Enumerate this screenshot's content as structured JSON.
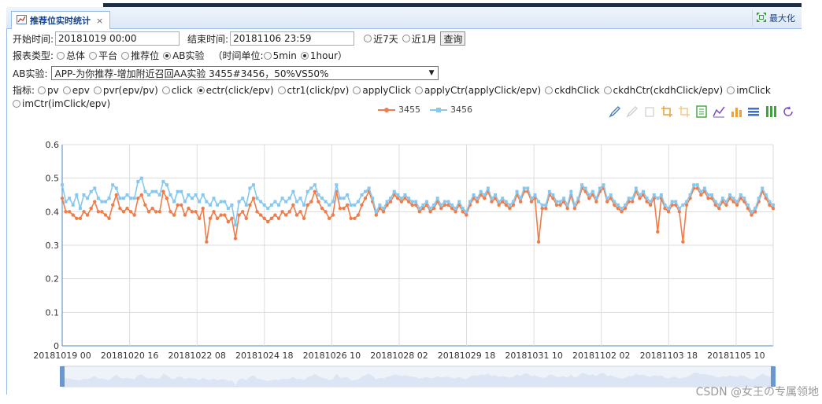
{
  "tab": {
    "title": "推荐位实时统计",
    "close": "×",
    "maximize": "最大化"
  },
  "filters": {
    "start_label": "开始时间:",
    "start_value": "20181019 00:00",
    "end_label": "结束时间:",
    "end_value": "20181106 23:59",
    "range_options": [
      {
        "label": "近7天",
        "checked": false
      },
      {
        "label": "近1月",
        "checked": false
      }
    ],
    "query_button": "查询"
  },
  "report": {
    "label": "报表类型:",
    "types": [
      {
        "label": "总体",
        "checked": false
      },
      {
        "label": "平台",
        "checked": false
      },
      {
        "label": "推荐位",
        "checked": false
      },
      {
        "label": "AB实验",
        "checked": true
      }
    ],
    "unit_label": "（时间单位:",
    "units": [
      {
        "label": "5min",
        "checked": false
      },
      {
        "label": "1hour",
        "checked": true
      }
    ],
    "unit_close": "）"
  },
  "ab": {
    "label": "AB实验:",
    "selected": "APP-为你推荐-增加附近召回AA实验 3455#3456，50%VS50%"
  },
  "metrics": {
    "label": "指标:",
    "options": [
      {
        "label": "pv",
        "checked": false
      },
      {
        "label": "epv",
        "checked": false
      },
      {
        "label": "pvr(epv/pv)",
        "checked": false
      },
      {
        "label": "click",
        "checked": false
      },
      {
        "label": "ectr(click/epv)",
        "checked": true
      },
      {
        "label": "ctr1(click/pv)",
        "checked": false
      },
      {
        "label": "applyClick",
        "checked": false
      },
      {
        "label": "applyCtr(applyClick/epv)",
        "checked": false
      },
      {
        "label": "ckdhClick",
        "checked": false
      },
      {
        "label": "ckdhCtr(ckdhClick/epv)",
        "checked": false
      },
      {
        "label": "imClick",
        "checked": false
      },
      {
        "label": "imCtr(imClick/epv)",
        "checked": false
      }
    ]
  },
  "toolbox_icons": [
    "mark-pen-icon",
    "mark-undo-icon",
    "mark-clear-icon",
    "zoom-icon",
    "zoom-reset-icon",
    "data-view-icon",
    "line-chart-icon",
    "bar-chart-icon",
    "stack-icon",
    "tiled-icon",
    "restore-icon"
  ],
  "colors": {
    "s3455": "#f07c4a",
    "s3456": "#86c8ef",
    "accent": "#15428b"
  },
  "watermark": "CSDN @女王の专属领地",
  "chart_data": {
    "type": "line",
    "x_ticks": [
      "20181019 00",
      "20181020 16",
      "20181022 08",
      "20181024 18",
      "20181026 10",
      "20181028 02",
      "20181029 18",
      "20181031 10",
      "20181102 02",
      "20181103 18",
      "20181105 10"
    ],
    "ylim": [
      0,
      0.6
    ],
    "y_ticks": [
      "0",
      "0.1",
      "0.2",
      "0.3",
      "0.4",
      "0.5",
      "0.6"
    ],
    "grid": true,
    "legend_position": "top-center",
    "series": [
      {
        "name": "3455",
        "color": "#f07c4a",
        "values": [
          0.44,
          0.4,
          0.4,
          0.39,
          0.38,
          0.38,
          0.4,
          0.39,
          0.41,
          0.43,
          0.4,
          0.4,
          0.39,
          0.38,
          0.42,
          0.45,
          0.41,
          0.4,
          0.41,
          0.4,
          0.39,
          0.44,
          0.45,
          0.42,
          0.4,
          0.41,
          0.4,
          0.4,
          0.46,
          0.44,
          0.4,
          0.39,
          0.42,
          0.42,
          0.39,
          0.41,
          0.4,
          0.4,
          0.38,
          0.41,
          0.39,
          0.38,
          0.4,
          0.38,
          0.39,
          0.39,
          0.37,
          0.38,
          0.32,
          0.39,
          0.4,
          0.38,
          0.42,
          0.44,
          0.4,
          0.39,
          0.38,
          0.37,
          0.38,
          0.39,
          0.38,
          0.4,
          0.39,
          0.4,
          0.42,
          0.39,
          0.4,
          0.38,
          0.42,
          0.43,
          0.46,
          0.43,
          0.41,
          0.4,
          0.38,
          0.39,
          0.46,
          0.41,
          0.41,
          0.42,
          0.38,
          0.38,
          0.39,
          0.42,
          0.44,
          0.46,
          0.43,
          0.39,
          0.41,
          0.4,
          0.42,
          0.43,
          0.45,
          0.44,
          0.43,
          0.44,
          0.43,
          0.42,
          0.42,
          0.4,
          0.41,
          0.42,
          0.4,
          0.41,
          0.43,
          0.41,
          0.42,
          0.42,
          0.41,
          0.4,
          0.42,
          0.4,
          0.39,
          0.42,
          0.44,
          0.43,
          0.45,
          0.44,
          0.46,
          0.43,
          0.44,
          0.42,
          0.43,
          0.42,
          0.41,
          0.42,
          0.45,
          0.43,
          0.46,
          0.46,
          0.43,
          0.44,
          0.42,
          0.41,
          0.41,
          0.45,
          0.44,
          0.42,
          0.42,
          0.43,
          0.41,
          0.45,
          0.41,
          0.43,
          0.47,
          0.46,
          0.44,
          0.45,
          0.43,
          0.46,
          0.47,
          0.43,
          0.44,
          0.42,
          0.41,
          0.4,
          0.41,
          0.43,
          0.43,
          0.46,
          0.44,
          0.45,
          0.43,
          0.42,
          0.44,
          0.43,
          0.44,
          0.41,
          0.4,
          0.42,
          0.42,
          0.4,
          0.41,
          0.42,
          0.44,
          0.47,
          0.47,
          0.45,
          0.46,
          0.44,
          0.44,
          0.42,
          0.41,
          0.43,
          0.42,
          0.44,
          0.43,
          0.42,
          0.44,
          0.43,
          0.41,
          0.39,
          0.4,
          0.43,
          0.46,
          0.44,
          0.42,
          0.41
        ],
        "dips": [
          [
            132,
            0.31
          ],
          [
            165,
            0.34
          ],
          [
            172,
            0.31
          ],
          [
            40,
            0.31
          ]
        ]
      },
      {
        "name": "3456",
        "color": "#86c8ef",
        "values": [
          0.48,
          0.43,
          0.44,
          0.42,
          0.45,
          0.41,
          0.45,
          0.44,
          0.46,
          0.47,
          0.44,
          0.43,
          0.43,
          0.44,
          0.48,
          0.47,
          0.44,
          0.44,
          0.45,
          0.44,
          0.44,
          0.49,
          0.5,
          0.46,
          0.45,
          0.46,
          0.46,
          0.45,
          0.49,
          0.48,
          0.45,
          0.43,
          0.46,
          0.46,
          0.43,
          0.45,
          0.44,
          0.45,
          0.43,
          0.45,
          0.43,
          0.42,
          0.44,
          0.42,
          0.43,
          0.43,
          0.41,
          0.42,
          0.36,
          0.43,
          0.44,
          0.42,
          0.47,
          0.48,
          0.44,
          0.43,
          0.42,
          0.41,
          0.42,
          0.43,
          0.42,
          0.44,
          0.43,
          0.44,
          0.46,
          0.43,
          0.44,
          0.42,
          0.46,
          0.47,
          0.48,
          0.45,
          0.44,
          0.43,
          0.42,
          0.43,
          0.48,
          0.44,
          0.44,
          0.45,
          0.42,
          0.42,
          0.43,
          0.45,
          0.46,
          0.47,
          0.44,
          0.4,
          0.42,
          0.41,
          0.43,
          0.44,
          0.46,
          0.45,
          0.44,
          0.45,
          0.44,
          0.43,
          0.43,
          0.41,
          0.42,
          0.43,
          0.41,
          0.42,
          0.44,
          0.42,
          0.43,
          0.43,
          0.42,
          0.41,
          0.43,
          0.41,
          0.4,
          0.43,
          0.45,
          0.44,
          0.46,
          0.45,
          0.47,
          0.44,
          0.45,
          0.43,
          0.44,
          0.43,
          0.42,
          0.43,
          0.46,
          0.44,
          0.47,
          0.47,
          0.44,
          0.45,
          0.43,
          0.42,
          0.42,
          0.46,
          0.45,
          0.43,
          0.43,
          0.44,
          0.42,
          0.46,
          0.42,
          0.44,
          0.48,
          0.47,
          0.45,
          0.46,
          0.44,
          0.47,
          0.48,
          0.44,
          0.45,
          0.43,
          0.42,
          0.41,
          0.42,
          0.44,
          0.44,
          0.47,
          0.45,
          0.46,
          0.44,
          0.43,
          0.45,
          0.44,
          0.45,
          0.42,
          0.41,
          0.43,
          0.43,
          0.41,
          0.42,
          0.43,
          0.45,
          0.48,
          0.48,
          0.46,
          0.47,
          0.45,
          0.45,
          0.43,
          0.42,
          0.44,
          0.43,
          0.45,
          0.44,
          0.43,
          0.45,
          0.44,
          0.42,
          0.4,
          0.41,
          0.44,
          0.47,
          0.45,
          0.43,
          0.42
        ]
      }
    ]
  }
}
